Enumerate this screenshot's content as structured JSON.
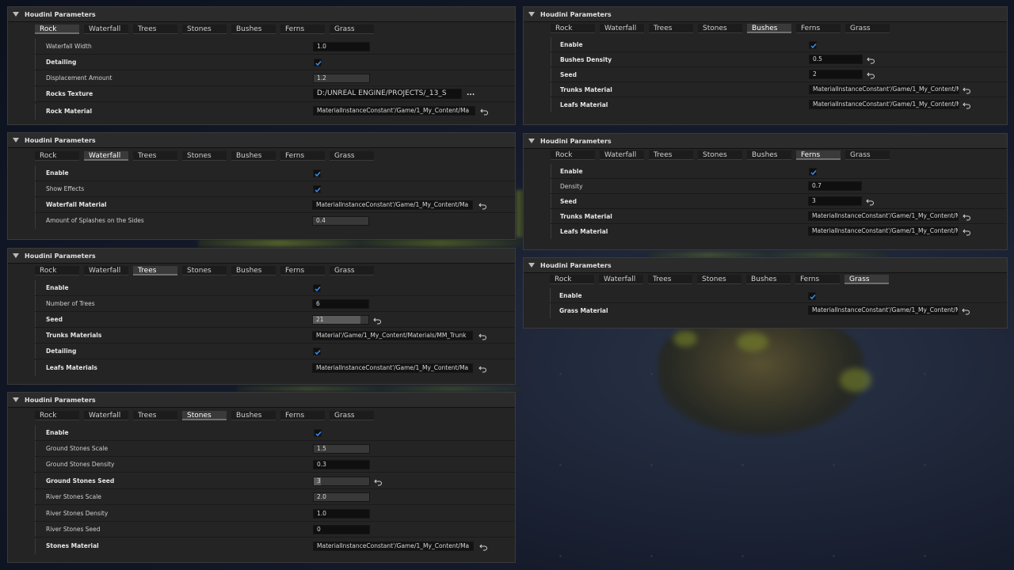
{
  "panel_title": "Houdini Parameters",
  "tabs": [
    "Rock",
    "Waterfall",
    "Trees",
    "Stones",
    "Bushes",
    "Ferns",
    "Grass"
  ],
  "panels": {
    "rock": {
      "active_tab": "Rock",
      "rows": {
        "waterfall_width": {
          "label": "Waterfall Width",
          "value": "1.0"
        },
        "detailing": {
          "label": "Detailing",
          "checked": true
        },
        "displacement": {
          "label": "Displacement Amount",
          "value": "1.2"
        },
        "rocks_texture": {
          "label": "Rocks Texture",
          "value": "D:/UNREAL ENGINE/PROJECTS/_13_S",
          "more": "..."
        },
        "rock_material": {
          "label": "Rock Material",
          "value": "MaterialInstanceConstant'/Game/1_My_Content/Ma"
        }
      }
    },
    "waterfall": {
      "active_tab": "Waterfall",
      "rows": {
        "enable": {
          "label": "Enable",
          "checked": true
        },
        "show_effects": {
          "label": "Show Effects",
          "checked": true
        },
        "waterfall_material": {
          "label": "Waterfall Material",
          "value": "MaterialInstanceConstant'/Game/1_My_Content/Ma"
        },
        "splashes": {
          "label": "Amount of Splashes on the Sides",
          "value": "0.4"
        }
      }
    },
    "trees": {
      "active_tab": "Trees",
      "rows": {
        "enable": {
          "label": "Enable",
          "checked": true
        },
        "number_of_trees": {
          "label": "Number of Trees",
          "value": "6"
        },
        "seed": {
          "label": "Seed",
          "value": "21"
        },
        "trunks_materials": {
          "label": "Trunks Materials",
          "value": "Material'/Game/1_My_Content/Materials/MM_Trunk"
        },
        "detailing": {
          "label": "Detailing",
          "checked": true
        },
        "leafs_materials": {
          "label": "Leafs Materials",
          "value": "MaterialInstanceConstant'/Game/1_My_Content/Ma"
        }
      }
    },
    "stones": {
      "active_tab": "Stones",
      "rows": {
        "enable": {
          "label": "Enable",
          "checked": true
        },
        "ground_scale": {
          "label": "Ground Stones Scale",
          "value": "1.5"
        },
        "ground_density": {
          "label": "Ground Stones Density",
          "value": "0.3"
        },
        "ground_seed": {
          "label": "Ground Stones Seed",
          "value": "3"
        },
        "river_scale": {
          "label": "River Stones Scale",
          "value": "2.0"
        },
        "river_density": {
          "label": "River Stones Density",
          "value": "1.0"
        },
        "river_seed": {
          "label": "River Stones Seed",
          "value": "0"
        },
        "stones_material": {
          "label": "Stones Material",
          "value": "MaterialInstanceConstant'/Game/1_My_Content/Ma"
        }
      }
    },
    "bushes": {
      "active_tab": "Bushes",
      "rows": {
        "enable": {
          "label": "Enable",
          "checked": true
        },
        "density": {
          "label": "Bushes Density",
          "value": "0.5"
        },
        "seed": {
          "label": "Seed",
          "value": "2"
        },
        "trunks_material": {
          "label": "Trunks Material",
          "value": "MaterialInstanceConstant'/Game/1_My_Content/Ma"
        },
        "leafs_material": {
          "label": "Leafs Material",
          "value": "MaterialInstanceConstant'/Game/1_My_Content/Ma"
        }
      }
    },
    "ferns": {
      "active_tab": "Ferns",
      "rows": {
        "enable": {
          "label": "Enable",
          "checked": true
        },
        "density": {
          "label": "Density",
          "value": "0.7"
        },
        "seed": {
          "label": "Seed",
          "value": "3"
        },
        "trunks_material": {
          "label": "Trunks Material",
          "value": "MaterialInstanceConstant'/Game/1_My_Content/Ma"
        },
        "leafs_material": {
          "label": "Leafs Material",
          "value": "MaterialInstanceConstant'/Game/1_My_Content/Ma"
        }
      }
    },
    "grass": {
      "active_tab": "Grass",
      "rows": {
        "enable": {
          "label": "Enable",
          "checked": true
        },
        "grass_material": {
          "label": "Grass Material",
          "value": "MaterialInstanceConstant'/Game/1_My_Content/Ma"
        }
      }
    }
  },
  "colors": {
    "panel_bg": "#242424",
    "checkbox_blue": "#3a8ef0",
    "field_bg": "#0f0f0f"
  },
  "icons": {
    "collapse": "caret-down-icon",
    "reset": "reset-arrow-icon",
    "check": "checkmark-icon",
    "browse": "ellipsis-icon"
  }
}
